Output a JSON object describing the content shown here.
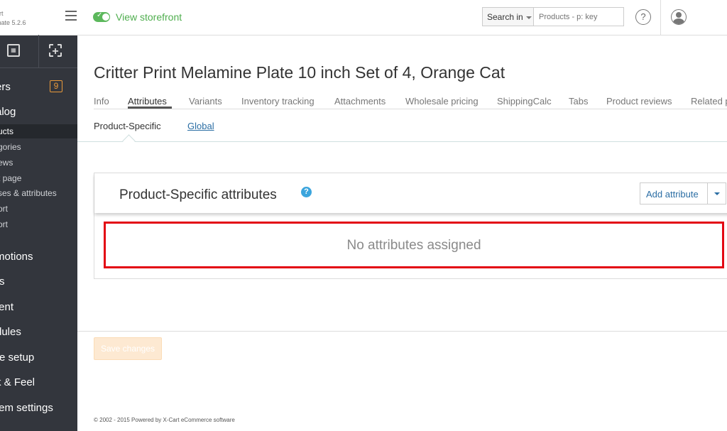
{
  "brand": {
    "line1": "ort",
    "line2": "mate 5.2.6"
  },
  "sidebar": {
    "nav": [
      {
        "label": "ers",
        "badge": "9"
      },
      {
        "label": "alog"
      },
      {
        "label": "motions"
      },
      {
        "label": "rs"
      },
      {
        "label": "tent"
      },
      {
        "label": "dules"
      },
      {
        "label": "re setup"
      },
      {
        "label": "k & Feel"
      },
      {
        "label": "tem settings"
      }
    ],
    "catalog_items": [
      {
        "label": "ucts",
        "active": true
      },
      {
        "label": "gories"
      },
      {
        "label": "ews"
      },
      {
        "label": "t page"
      },
      {
        "label": "ses & attributes"
      },
      {
        "label": "ort"
      },
      {
        "label": "ort"
      }
    ]
  },
  "topbar": {
    "storefront_label": "View storefront",
    "search_in_label": "Search in",
    "search_placeholder": "Products - p: key",
    "help_symbol": "?"
  },
  "page": {
    "title": "Critter Print Melamine Plate 10 inch Set of 4, Orange Cat"
  },
  "tabs": [
    {
      "label": "Info"
    },
    {
      "label": "Attributes",
      "active": true
    },
    {
      "label": "Variants"
    },
    {
      "label": "Inventory tracking"
    },
    {
      "label": "Attachments"
    },
    {
      "label": "Wholesale pricing"
    },
    {
      "label": "ShippingCalc"
    },
    {
      "label": "Tabs"
    },
    {
      "label": "Product reviews"
    },
    {
      "label": "Related p"
    }
  ],
  "subtabs": {
    "active": "Product-Specific",
    "other": "Global"
  },
  "panel": {
    "title": "Product-Specific attributes",
    "help_symbol": "?",
    "add_button": "Add attribute",
    "empty_message": "No attributes assigned"
  },
  "actions": {
    "save_label": "Save changes"
  },
  "footer": {
    "text": "© 2002 - 2015 Powered by X-Cart eCommerce software"
  },
  "colors": {
    "sidebar_bg": "#33363d",
    "storefront_green": "#4fae4e",
    "highlight_red": "#e30613",
    "badge_orange": "#e8993b"
  }
}
